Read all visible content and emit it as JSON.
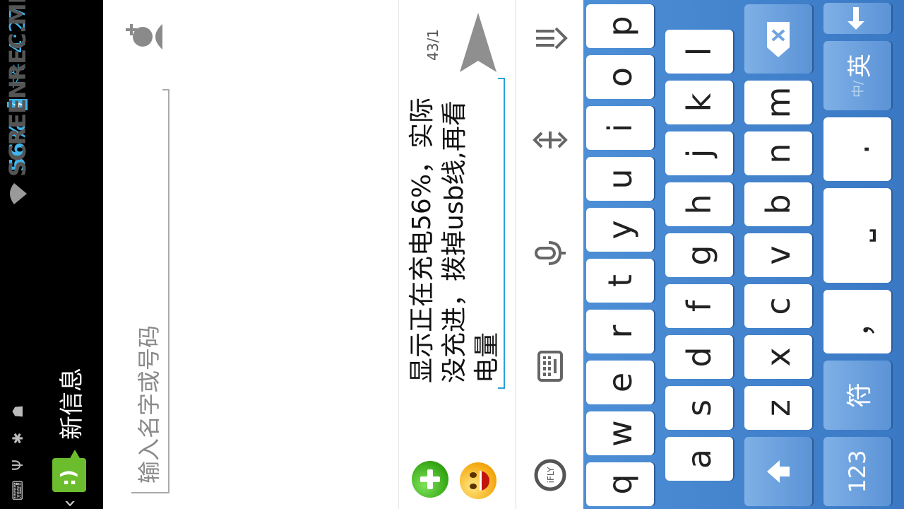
{
  "status_bar": {
    "battery_pct": "56%",
    "ampm": "下午",
    "time": "4:27",
    "watermark": "SCREENREC.ME"
  },
  "action_bar": {
    "title": "新信息"
  },
  "recipient": {
    "placeholder": "输入名字或号码"
  },
  "compose": {
    "message": "显示正在充电56%，实际没充进，拨掉usb线,再看电量",
    "counter": "43/1"
  },
  "keyboard": {
    "row1": [
      "q",
      "w",
      "e",
      "r",
      "t",
      "y",
      "u",
      "i",
      "o",
      "p"
    ],
    "row2": [
      "a",
      "s",
      "d",
      "f",
      "g",
      "h",
      "j",
      "k",
      "l"
    ],
    "row3": [
      "z",
      "x",
      "c",
      "v",
      "b",
      "n",
      "m"
    ],
    "row4": {
      "num": "123",
      "sym": "符",
      "comma": "，",
      "space": "⎵",
      "period": ".",
      "lang_sub": "中/",
      "lang_main": "英"
    }
  },
  "colors": {
    "accent": "#3fb4ea",
    "keyboard_bg": "#4d8fd6",
    "app_green": "#6cbd2e"
  }
}
